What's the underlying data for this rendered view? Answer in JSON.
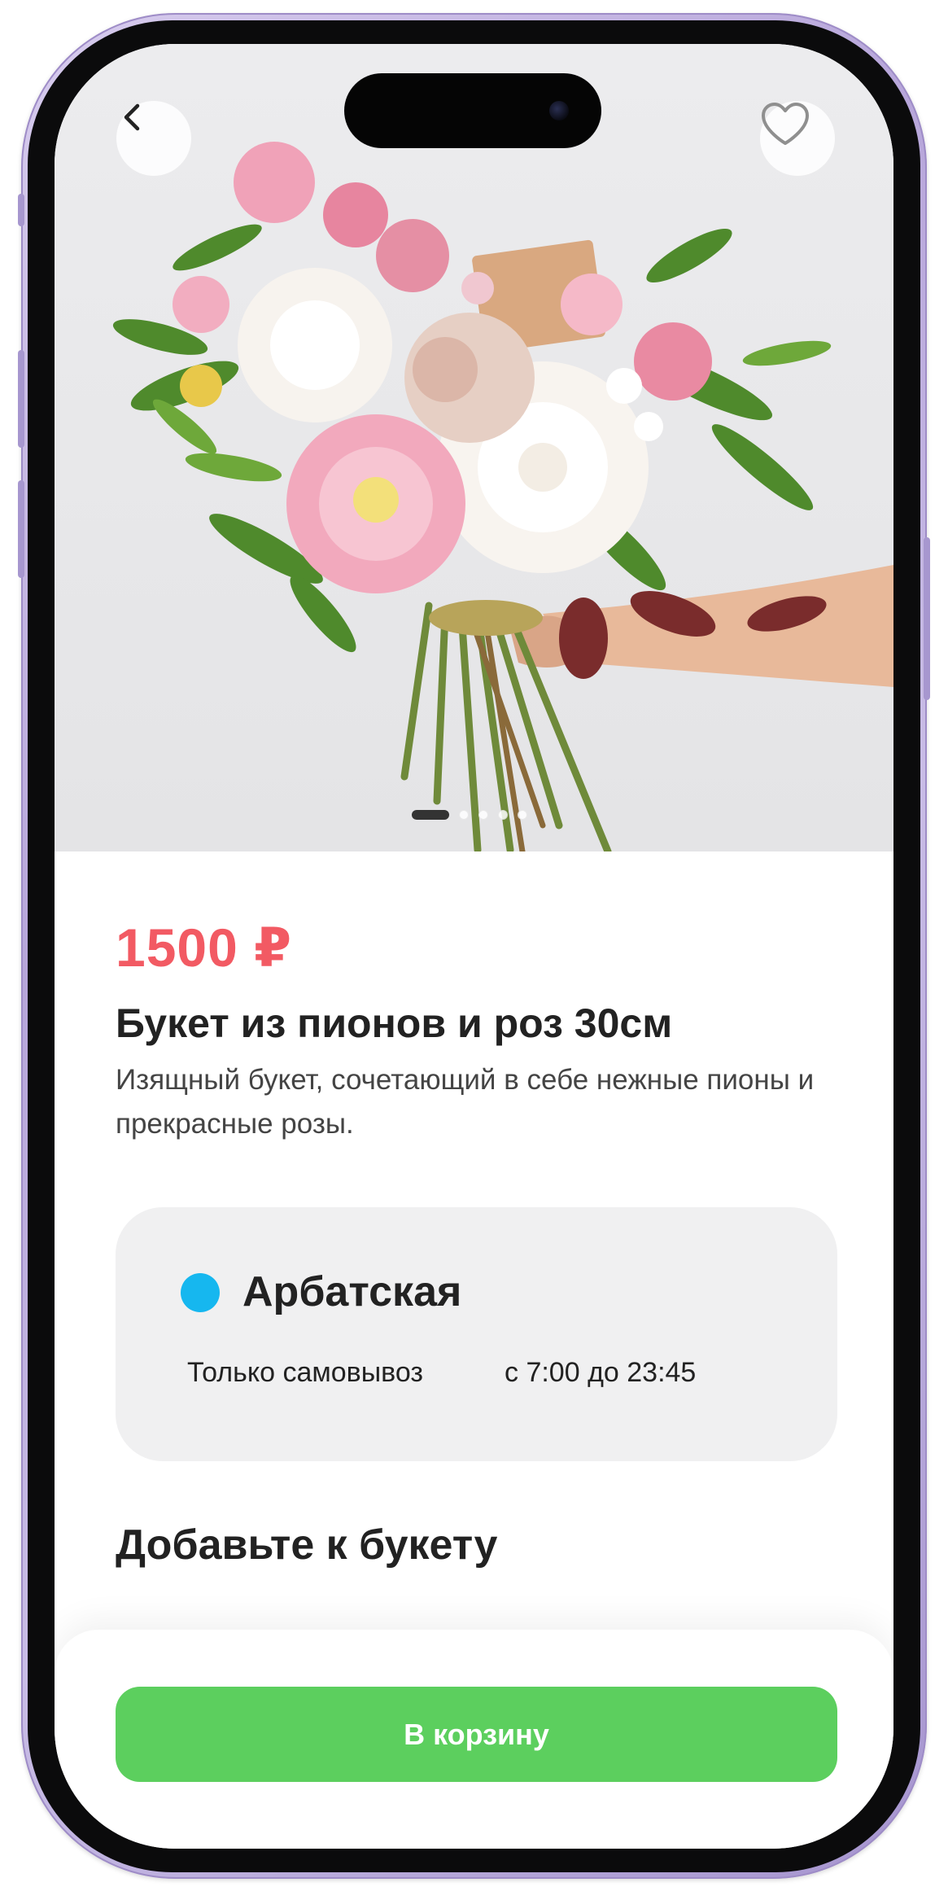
{
  "product": {
    "price": "1500 ₽",
    "title": "Букет из пионов и роз 30см",
    "description": "Изящный букет, сочетающий в себе нежные пионы и прекрасные розы."
  },
  "gallery": {
    "slide_count": 5,
    "active_slide": 1
  },
  "pickup": {
    "station": "Арбатская",
    "station_color": "#16b7ef",
    "mode": "Только самовывоз",
    "hours": "с 7:00 до 23:45"
  },
  "addons": {
    "title": "Добавьте к букету"
  },
  "actions": {
    "cart_label": "В корзину"
  },
  "colors": {
    "accent_price": "#f25a63",
    "primary_button": "#5ccf5e",
    "frame": "#b7a6da"
  },
  "icons": {
    "back": "chevron-left-icon",
    "favorite": "heart-icon"
  }
}
